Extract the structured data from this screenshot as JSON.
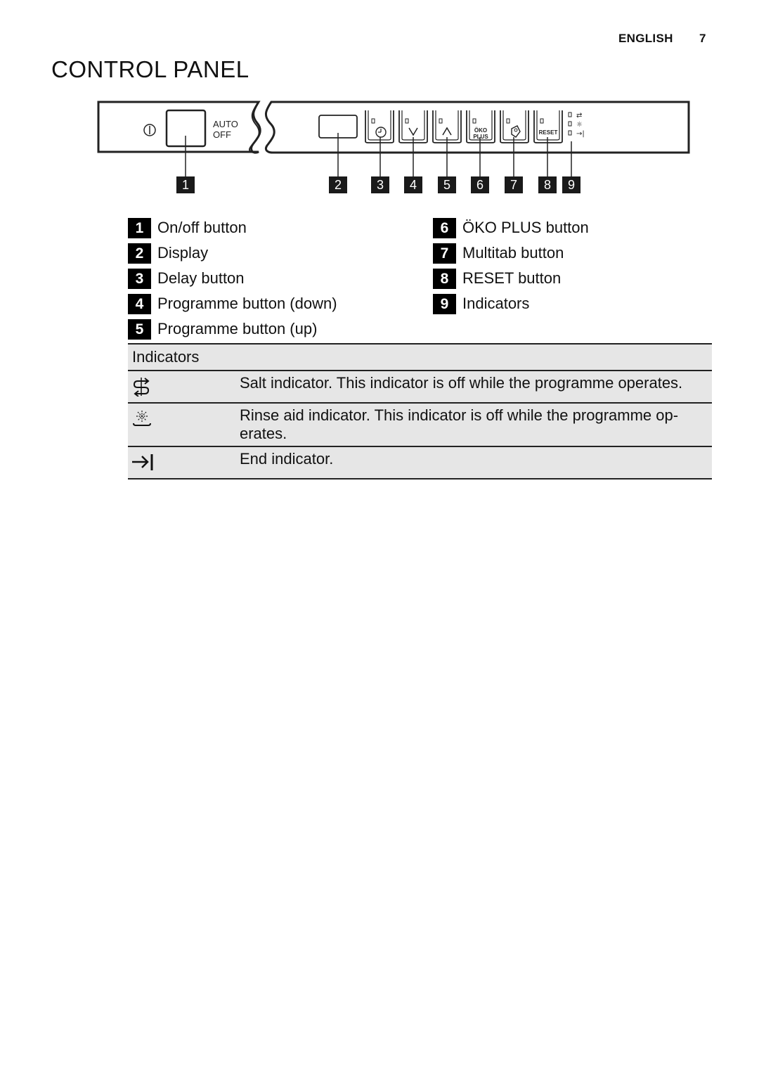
{
  "header": {
    "language": "ENGLISH",
    "page_number": "7"
  },
  "page_title": "CONTROL PANEL",
  "diagram": {
    "auto_off_label": [
      "AUTO",
      "OFF"
    ],
    "oko_plus_label": [
      "ÖKO",
      "PLUS"
    ],
    "reset_label": "RESET",
    "callouts": [
      "1",
      "2",
      "3",
      "4",
      "5",
      "6",
      "7",
      "8",
      "9"
    ]
  },
  "legend": {
    "left": [
      {
        "num": "1",
        "label": "On/off button"
      },
      {
        "num": "2",
        "label": "Display"
      },
      {
        "num": "3",
        "label": "Delay button"
      },
      {
        "num": "4",
        "label": "Programme button (down)"
      },
      {
        "num": "5",
        "label": "Programme button (up)"
      }
    ],
    "right": [
      {
        "num": "6",
        "label": "ÖKO PLUS button"
      },
      {
        "num": "7",
        "label": "Multitab button"
      },
      {
        "num": "8",
        "label": "RESET button"
      },
      {
        "num": "9",
        "label": "Indicators"
      }
    ]
  },
  "indicators_table": {
    "header": "Indicators",
    "rows": [
      {
        "icon": "salt-icon",
        "description": "Salt indicator. This indicator is off while the programme operates."
      },
      {
        "icon": "rinse-aid-icon",
        "description_lines": [
          "Rinse aid indicator. This indicator is off while the programme op-",
          "erates."
        ]
      },
      {
        "icon": "end-icon",
        "description": "End indicator."
      }
    ]
  }
}
